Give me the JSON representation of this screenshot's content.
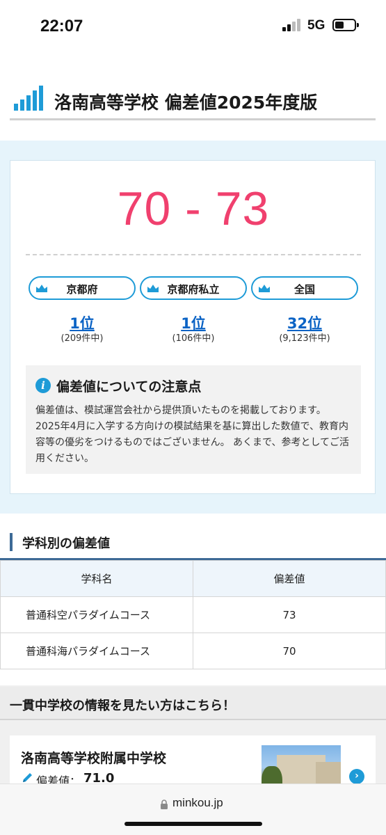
{
  "status_bar": {
    "time": "22:07",
    "network": "5G",
    "battery_level": 0.45
  },
  "page": {
    "title": "洛南高等学校 偏差値2025年度版",
    "score_range": "70 - 73",
    "rankings": [
      {
        "region": "京都府",
        "rank": "1位",
        "count": "(209件中)"
      },
      {
        "region": "京都府私立",
        "rank": "1位",
        "count": "(106件中)"
      },
      {
        "region": "全国",
        "rank": "32位",
        "count": "(9,123件中)"
      }
    ],
    "notice": {
      "icon": "info-icon",
      "title": "偏差値についての注意点",
      "body": "偏差値は、模試運営会社から提供頂いたものを掲載しております。 2025年4月に入学する方向けの模試結果を基に算出した数値で、教育内容等の優劣をつけるものではございません。 あくまで、参考としてご活用ください。"
    }
  },
  "departments": {
    "heading": "学科別の偏差値",
    "columns": [
      "学科名",
      "偏差値"
    ],
    "rows": [
      {
        "name": "普通科空パラダイムコース",
        "value": "73"
      },
      {
        "name": "普通科海パラダイムコース",
        "value": "70"
      }
    ]
  },
  "junior_high": {
    "heading": "一貫中学校の情報を見たい方はこちら！",
    "school_name": "洛南高等学校附属中学校",
    "deviation_label": "偏差値：",
    "deviation_value": "71.0"
  },
  "browser": {
    "url": "minkou.jp"
  },
  "colors": {
    "accent": "#1e9bd7",
    "score": "#f0406e",
    "link": "#0b63c5",
    "section": "#3d6a96"
  }
}
